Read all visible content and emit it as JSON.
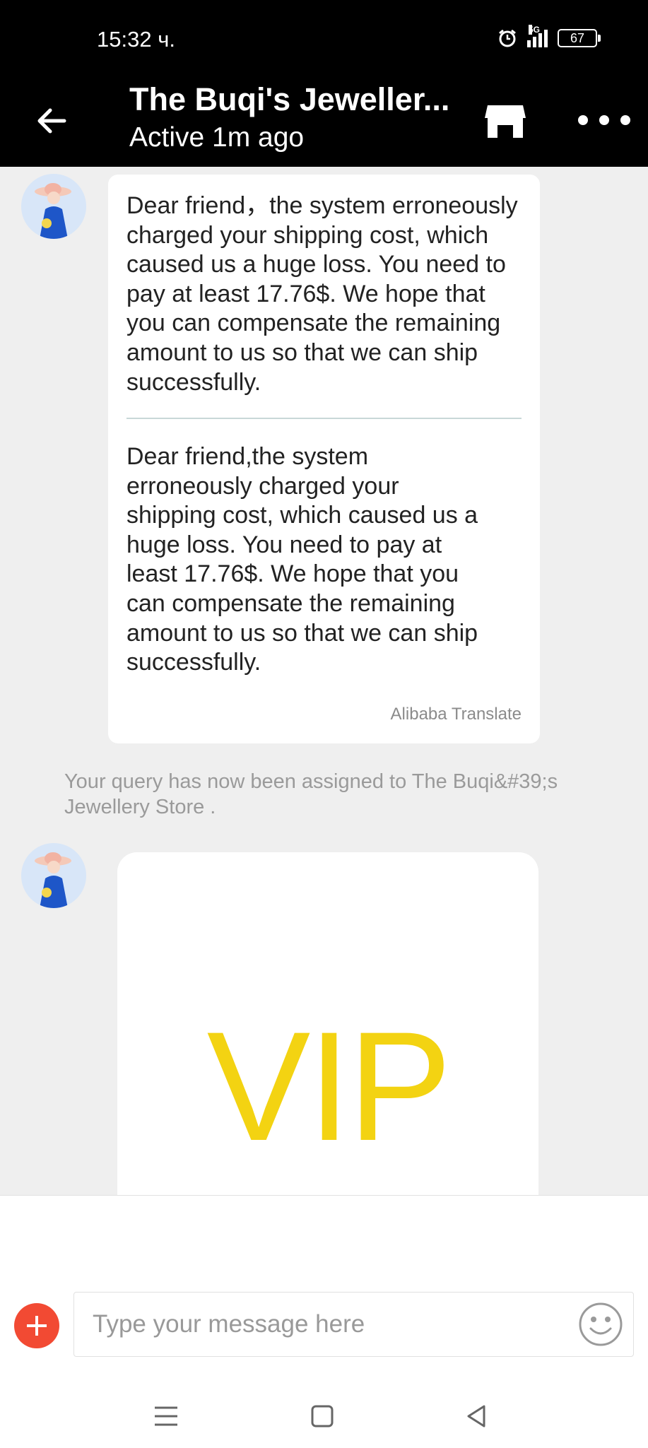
{
  "status_bar": {
    "time": "15:32 ч.",
    "network": "5G",
    "battery": "67"
  },
  "header": {
    "title": "The Buqi's Jeweller...",
    "subtitle": "Active 1m ago"
  },
  "messages": {
    "original_text": "Dear friend，the system erroneously charged your shipping cost, which caused us a huge loss. You need to pay at least 17.76$. We hope that you can compensate the remaining amount to us so that we can ship successfully.",
    "translated_text": "Dear friend,the system erroneously charged your shipping cost, which caused us a huge loss. You need to pay at least 17.76$. We hope that you can compensate the remaining amount to us so that we can ship successfully.",
    "translate_label": "Alibaba Translate",
    "system_message": "Your query has now been assigned to The Buqi&#39;s Jewellery Store .",
    "vip_text": "VIP"
  },
  "composer": {
    "placeholder": "Type your message here"
  },
  "colors": {
    "accent": "#f24a33",
    "vip": "#f3d312",
    "header_bg": "#000000"
  }
}
